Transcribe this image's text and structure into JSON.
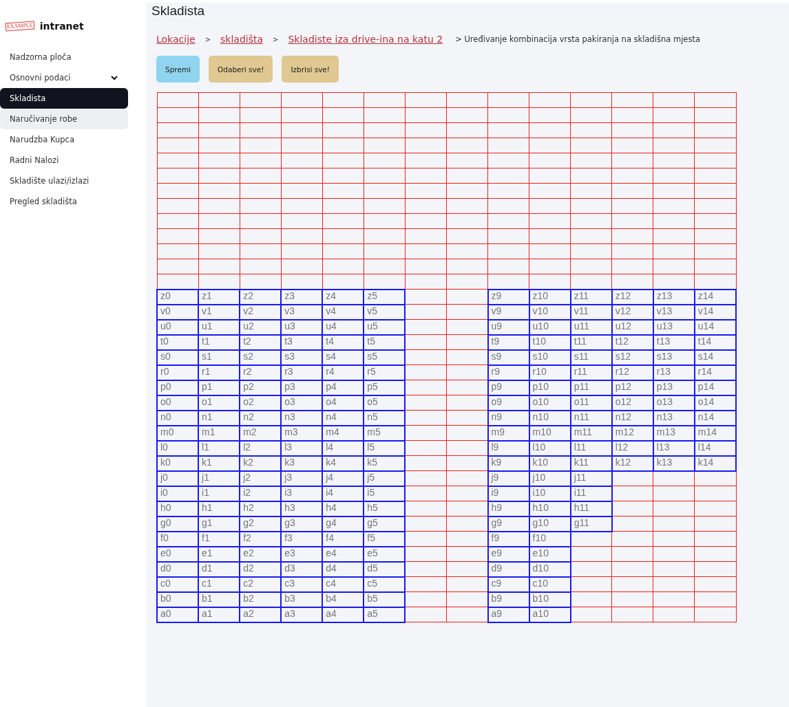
{
  "sidebar": {
    "logo_stamp": "EXAMPLE",
    "logo_text": "intranet",
    "items": [
      {
        "label": "Nadzorna ploča",
        "kind": "link",
        "selected": false,
        "hovered": false
      },
      {
        "label": "Osnovni podaci",
        "kind": "group",
        "selected": false,
        "hovered": false
      },
      {
        "label": "Skladista",
        "kind": "link",
        "selected": true,
        "hovered": false
      },
      {
        "label": "Naručivanje robe",
        "kind": "link",
        "selected": false,
        "hovered": true
      },
      {
        "label": "Narudzba Kupca",
        "kind": "link",
        "selected": false,
        "hovered": false
      },
      {
        "label": "Radni Nalozi",
        "kind": "link",
        "selected": false,
        "hovered": false
      },
      {
        "label": "Skladište ulazi/izlazi",
        "kind": "link",
        "selected": false,
        "hovered": false
      },
      {
        "label": "Pregled skladišta",
        "kind": "link",
        "selected": false,
        "hovered": false
      }
    ]
  },
  "page_title": "Skladista",
  "breadcrumbs": [
    {
      "label": "Lokacije",
      "kind": "link"
    },
    {
      "label": ">",
      "kind": "separator"
    },
    {
      "label": "skladišta",
      "kind": "link"
    },
    {
      "label": ">",
      "kind": "separator"
    },
    {
      "label": "Skladiste iza drive-ina na katu 2",
      "kind": "link"
    },
    {
      "label": "> Uređivanje kombinacija vrsta pakiranja na skladišna mjesta",
      "kind": "current"
    }
  ],
  "buttons": [
    {
      "label": "Spremi",
      "kind": "primary"
    },
    {
      "label": "Odaberi sve!",
      "kind": "secondary"
    },
    {
      "label": "Izbrisi sve!",
      "kind": "secondary"
    }
  ],
  "grid": {
    "rows": [
      {
        "cells": [
          {
            "kind": "empty"
          },
          {
            "kind": "empty"
          },
          {
            "kind": "empty"
          },
          {
            "kind": "empty"
          },
          {
            "kind": "empty"
          },
          {
            "kind": "empty"
          },
          {
            "kind": "empty"
          },
          {
            "kind": "empty"
          },
          {
            "kind": "empty"
          },
          {
            "kind": "empty"
          },
          {
            "kind": "empty"
          },
          {
            "kind": "empty"
          },
          {
            "kind": "empty"
          },
          {
            "kind": "empty"
          }
        ]
      },
      {
        "cells": [
          {
            "kind": "empty"
          },
          {
            "kind": "empty"
          },
          {
            "kind": "empty"
          },
          {
            "kind": "empty"
          },
          {
            "kind": "empty"
          },
          {
            "kind": "empty"
          },
          {
            "kind": "empty"
          },
          {
            "kind": "empty"
          },
          {
            "kind": "empty"
          },
          {
            "kind": "empty"
          },
          {
            "kind": "empty"
          },
          {
            "kind": "empty"
          },
          {
            "kind": "empty"
          },
          {
            "kind": "empty"
          }
        ]
      },
      {
        "cells": [
          {
            "kind": "empty"
          },
          {
            "kind": "empty"
          },
          {
            "kind": "empty"
          },
          {
            "kind": "empty"
          },
          {
            "kind": "empty"
          },
          {
            "kind": "empty"
          },
          {
            "kind": "empty"
          },
          {
            "kind": "empty"
          },
          {
            "kind": "empty"
          },
          {
            "kind": "empty"
          },
          {
            "kind": "empty"
          },
          {
            "kind": "empty"
          },
          {
            "kind": "empty"
          },
          {
            "kind": "empty"
          }
        ]
      },
      {
        "cells": [
          {
            "kind": "empty"
          },
          {
            "kind": "empty"
          },
          {
            "kind": "empty"
          },
          {
            "kind": "empty"
          },
          {
            "kind": "empty"
          },
          {
            "kind": "empty"
          },
          {
            "kind": "empty"
          },
          {
            "kind": "empty"
          },
          {
            "kind": "empty"
          },
          {
            "kind": "empty"
          },
          {
            "kind": "empty"
          },
          {
            "kind": "empty"
          },
          {
            "kind": "empty"
          },
          {
            "kind": "empty"
          }
        ]
      },
      {
        "cells": [
          {
            "kind": "empty"
          },
          {
            "kind": "empty"
          },
          {
            "kind": "empty"
          },
          {
            "kind": "empty"
          },
          {
            "kind": "empty"
          },
          {
            "kind": "empty"
          },
          {
            "kind": "empty"
          },
          {
            "kind": "empty"
          },
          {
            "kind": "empty"
          },
          {
            "kind": "empty"
          },
          {
            "kind": "empty"
          },
          {
            "kind": "empty"
          },
          {
            "kind": "empty"
          },
          {
            "kind": "empty"
          }
        ]
      },
      {
        "cells": [
          {
            "kind": "empty"
          },
          {
            "kind": "empty"
          },
          {
            "kind": "empty"
          },
          {
            "kind": "empty"
          },
          {
            "kind": "empty"
          },
          {
            "kind": "empty"
          },
          {
            "kind": "empty"
          },
          {
            "kind": "empty"
          },
          {
            "kind": "empty"
          },
          {
            "kind": "empty"
          },
          {
            "kind": "empty"
          },
          {
            "kind": "empty"
          },
          {
            "kind": "empty"
          },
          {
            "kind": "empty"
          }
        ]
      },
      {
        "cells": [
          {
            "kind": "empty"
          },
          {
            "kind": "empty"
          },
          {
            "kind": "empty"
          },
          {
            "kind": "empty"
          },
          {
            "kind": "empty"
          },
          {
            "kind": "empty"
          },
          {
            "kind": "empty"
          },
          {
            "kind": "empty"
          },
          {
            "kind": "empty"
          },
          {
            "kind": "empty"
          },
          {
            "kind": "empty"
          },
          {
            "kind": "empty"
          },
          {
            "kind": "empty"
          },
          {
            "kind": "empty"
          }
        ]
      },
      {
        "cells": [
          {
            "kind": "empty"
          },
          {
            "kind": "empty"
          },
          {
            "kind": "empty"
          },
          {
            "kind": "empty"
          },
          {
            "kind": "empty"
          },
          {
            "kind": "empty"
          },
          {
            "kind": "empty"
          },
          {
            "kind": "empty"
          },
          {
            "kind": "empty"
          },
          {
            "kind": "empty"
          },
          {
            "kind": "empty"
          },
          {
            "kind": "empty"
          },
          {
            "kind": "empty"
          },
          {
            "kind": "empty"
          }
        ]
      },
      {
        "cells": [
          {
            "kind": "empty"
          },
          {
            "kind": "empty"
          },
          {
            "kind": "empty"
          },
          {
            "kind": "empty"
          },
          {
            "kind": "empty"
          },
          {
            "kind": "empty"
          },
          {
            "kind": "empty"
          },
          {
            "kind": "empty"
          },
          {
            "kind": "empty"
          },
          {
            "kind": "empty"
          },
          {
            "kind": "empty"
          },
          {
            "kind": "empty"
          },
          {
            "kind": "empty"
          },
          {
            "kind": "empty"
          }
        ]
      },
      {
        "cells": [
          {
            "kind": "empty"
          },
          {
            "kind": "empty"
          },
          {
            "kind": "empty"
          },
          {
            "kind": "empty"
          },
          {
            "kind": "empty"
          },
          {
            "kind": "empty"
          },
          {
            "kind": "empty"
          },
          {
            "kind": "empty"
          },
          {
            "kind": "empty"
          },
          {
            "kind": "empty"
          },
          {
            "kind": "empty"
          },
          {
            "kind": "empty"
          },
          {
            "kind": "empty"
          },
          {
            "kind": "empty"
          }
        ]
      },
      {
        "cells": [
          {
            "kind": "empty"
          },
          {
            "kind": "empty"
          },
          {
            "kind": "empty"
          },
          {
            "kind": "empty"
          },
          {
            "kind": "empty"
          },
          {
            "kind": "empty"
          },
          {
            "kind": "empty"
          },
          {
            "kind": "empty"
          },
          {
            "kind": "empty"
          },
          {
            "kind": "empty"
          },
          {
            "kind": "empty"
          },
          {
            "kind": "empty"
          },
          {
            "kind": "empty"
          },
          {
            "kind": "empty"
          }
        ]
      },
      {
        "cells": [
          {
            "kind": "empty"
          },
          {
            "kind": "empty"
          },
          {
            "kind": "empty"
          },
          {
            "kind": "empty"
          },
          {
            "kind": "empty"
          },
          {
            "kind": "empty"
          },
          {
            "kind": "empty"
          },
          {
            "kind": "empty"
          },
          {
            "kind": "empty"
          },
          {
            "kind": "empty"
          },
          {
            "kind": "empty"
          },
          {
            "kind": "empty"
          },
          {
            "kind": "empty"
          },
          {
            "kind": "empty"
          }
        ]
      },
      {
        "cells": [
          {
            "kind": "empty"
          },
          {
            "kind": "empty"
          },
          {
            "kind": "empty"
          },
          {
            "kind": "empty"
          },
          {
            "kind": "empty"
          },
          {
            "kind": "empty"
          },
          {
            "kind": "empty"
          },
          {
            "kind": "empty"
          },
          {
            "kind": "empty"
          },
          {
            "kind": "empty"
          },
          {
            "kind": "empty"
          },
          {
            "kind": "empty"
          },
          {
            "kind": "empty"
          },
          {
            "kind": "empty"
          }
        ]
      },
      {
        "cells": [
          {
            "kind": "slot",
            "label": "z0"
          },
          {
            "kind": "slot",
            "label": "z1"
          },
          {
            "kind": "slot",
            "label": "z2"
          },
          {
            "kind": "slot",
            "label": "z3"
          },
          {
            "kind": "slot",
            "label": "z4"
          },
          {
            "kind": "slot",
            "label": "z5"
          },
          {
            "kind": "empty"
          },
          {
            "kind": "empty"
          },
          {
            "kind": "slot",
            "label": "z9"
          },
          {
            "kind": "slot",
            "label": "z10"
          },
          {
            "kind": "slot",
            "label": "z11"
          },
          {
            "kind": "slot",
            "label": "z12"
          },
          {
            "kind": "slot",
            "label": "z13"
          },
          {
            "kind": "slot",
            "label": "z14"
          }
        ]
      },
      {
        "cells": [
          {
            "kind": "slot",
            "label": "v0"
          },
          {
            "kind": "slot",
            "label": "v1"
          },
          {
            "kind": "slot",
            "label": "v2"
          },
          {
            "kind": "slot",
            "label": "v3"
          },
          {
            "kind": "slot",
            "label": "v4"
          },
          {
            "kind": "slot",
            "label": "v5"
          },
          {
            "kind": "empty"
          },
          {
            "kind": "empty"
          },
          {
            "kind": "slot",
            "label": "v9"
          },
          {
            "kind": "slot",
            "label": "v10"
          },
          {
            "kind": "slot",
            "label": "v11"
          },
          {
            "kind": "slot",
            "label": "v12"
          },
          {
            "kind": "slot",
            "label": "v13"
          },
          {
            "kind": "slot",
            "label": "v14"
          }
        ]
      },
      {
        "cells": [
          {
            "kind": "slot",
            "label": "u0"
          },
          {
            "kind": "slot",
            "label": "u1"
          },
          {
            "kind": "slot",
            "label": "u2"
          },
          {
            "kind": "slot",
            "label": "u3"
          },
          {
            "kind": "slot",
            "label": "u4"
          },
          {
            "kind": "slot",
            "label": "u5"
          },
          {
            "kind": "empty"
          },
          {
            "kind": "empty"
          },
          {
            "kind": "slot",
            "label": "u9"
          },
          {
            "kind": "slot",
            "label": "u10"
          },
          {
            "kind": "slot",
            "label": "u11"
          },
          {
            "kind": "slot",
            "label": "u12"
          },
          {
            "kind": "slot",
            "label": "u13"
          },
          {
            "kind": "slot",
            "label": "u14"
          }
        ]
      },
      {
        "cells": [
          {
            "kind": "slot",
            "label": "t0"
          },
          {
            "kind": "slot",
            "label": "t1"
          },
          {
            "kind": "slot",
            "label": "t2"
          },
          {
            "kind": "slot",
            "label": "t3"
          },
          {
            "kind": "slot",
            "label": "t4"
          },
          {
            "kind": "slot",
            "label": "t5"
          },
          {
            "kind": "empty"
          },
          {
            "kind": "empty"
          },
          {
            "kind": "slot",
            "label": "t9"
          },
          {
            "kind": "slot",
            "label": "t10"
          },
          {
            "kind": "slot",
            "label": "t11"
          },
          {
            "kind": "slot",
            "label": "t12"
          },
          {
            "kind": "slot",
            "label": "t13"
          },
          {
            "kind": "slot",
            "label": "t14"
          }
        ]
      },
      {
        "cells": [
          {
            "kind": "slot",
            "label": "s0"
          },
          {
            "kind": "slot",
            "label": "s1"
          },
          {
            "kind": "slot",
            "label": "s2"
          },
          {
            "kind": "slot",
            "label": "s3"
          },
          {
            "kind": "slot",
            "label": "s4"
          },
          {
            "kind": "slot",
            "label": "s5"
          },
          {
            "kind": "empty"
          },
          {
            "kind": "empty"
          },
          {
            "kind": "slot",
            "label": "s9"
          },
          {
            "kind": "slot",
            "label": "s10"
          },
          {
            "kind": "slot",
            "label": "s11"
          },
          {
            "kind": "slot",
            "label": "s12"
          },
          {
            "kind": "slot",
            "label": "s13"
          },
          {
            "kind": "slot",
            "label": "s14"
          }
        ]
      },
      {
        "cells": [
          {
            "kind": "slot",
            "label": "r0"
          },
          {
            "kind": "slot",
            "label": "r1"
          },
          {
            "kind": "slot",
            "label": "r2"
          },
          {
            "kind": "slot",
            "label": "r3"
          },
          {
            "kind": "slot",
            "label": "r4"
          },
          {
            "kind": "slot",
            "label": "r5"
          },
          {
            "kind": "empty"
          },
          {
            "kind": "empty"
          },
          {
            "kind": "slot",
            "label": "r9"
          },
          {
            "kind": "slot",
            "label": "r10"
          },
          {
            "kind": "slot",
            "label": "r11"
          },
          {
            "kind": "slot",
            "label": "r12"
          },
          {
            "kind": "slot",
            "label": "r13"
          },
          {
            "kind": "slot",
            "label": "r14"
          }
        ]
      },
      {
        "cells": [
          {
            "kind": "slot",
            "label": "p0"
          },
          {
            "kind": "slot",
            "label": "p1"
          },
          {
            "kind": "slot",
            "label": "p2"
          },
          {
            "kind": "slot",
            "label": "p3"
          },
          {
            "kind": "slot",
            "label": "p4"
          },
          {
            "kind": "slot",
            "label": "p5"
          },
          {
            "kind": "empty"
          },
          {
            "kind": "empty"
          },
          {
            "kind": "slot",
            "label": "p9"
          },
          {
            "kind": "slot",
            "label": "p10"
          },
          {
            "kind": "slot",
            "label": "p11"
          },
          {
            "kind": "slot",
            "label": "p12"
          },
          {
            "kind": "slot",
            "label": "p13"
          },
          {
            "kind": "slot",
            "label": "p14"
          }
        ]
      },
      {
        "cells": [
          {
            "kind": "slot",
            "label": "o0"
          },
          {
            "kind": "slot",
            "label": "o1"
          },
          {
            "kind": "slot",
            "label": "o2"
          },
          {
            "kind": "slot",
            "label": "o3"
          },
          {
            "kind": "slot",
            "label": "o4"
          },
          {
            "kind": "slot",
            "label": "o5"
          },
          {
            "kind": "empty"
          },
          {
            "kind": "empty"
          },
          {
            "kind": "slot",
            "label": "o9"
          },
          {
            "kind": "slot",
            "label": "o10"
          },
          {
            "kind": "slot",
            "label": "o11"
          },
          {
            "kind": "slot",
            "label": "o12"
          },
          {
            "kind": "slot",
            "label": "o13"
          },
          {
            "kind": "slot",
            "label": "o14"
          }
        ]
      },
      {
        "cells": [
          {
            "kind": "slot",
            "label": "n0"
          },
          {
            "kind": "slot",
            "label": "n1"
          },
          {
            "kind": "slot",
            "label": "n2"
          },
          {
            "kind": "slot",
            "label": "n3"
          },
          {
            "kind": "slot",
            "label": "n4"
          },
          {
            "kind": "slot",
            "label": "n5"
          },
          {
            "kind": "empty"
          },
          {
            "kind": "empty"
          },
          {
            "kind": "slot",
            "label": "n9"
          },
          {
            "kind": "slot",
            "label": "n10"
          },
          {
            "kind": "slot",
            "label": "n11"
          },
          {
            "kind": "slot",
            "label": "n12"
          },
          {
            "kind": "slot",
            "label": "n13"
          },
          {
            "kind": "slot",
            "label": "n14"
          }
        ]
      },
      {
        "cells": [
          {
            "kind": "slot",
            "label": "m0"
          },
          {
            "kind": "slot",
            "label": "m1"
          },
          {
            "kind": "slot",
            "label": "m2"
          },
          {
            "kind": "slot",
            "label": "m3"
          },
          {
            "kind": "slot",
            "label": "m4"
          },
          {
            "kind": "slot",
            "label": "m5"
          },
          {
            "kind": "empty"
          },
          {
            "kind": "empty"
          },
          {
            "kind": "slot",
            "label": "m9"
          },
          {
            "kind": "slot",
            "label": "m10"
          },
          {
            "kind": "slot",
            "label": "m11"
          },
          {
            "kind": "slot",
            "label": "m12"
          },
          {
            "kind": "slot",
            "label": "m13"
          },
          {
            "kind": "slot",
            "label": "m14"
          }
        ]
      },
      {
        "cells": [
          {
            "kind": "slot",
            "label": "l0"
          },
          {
            "kind": "slot",
            "label": "l1"
          },
          {
            "kind": "slot",
            "label": "l2"
          },
          {
            "kind": "slot",
            "label": "l3"
          },
          {
            "kind": "slot",
            "label": "l4"
          },
          {
            "kind": "slot",
            "label": "l5"
          },
          {
            "kind": "empty"
          },
          {
            "kind": "empty"
          },
          {
            "kind": "slot",
            "label": "l9"
          },
          {
            "kind": "slot",
            "label": "l10"
          },
          {
            "kind": "slot",
            "label": "l11"
          },
          {
            "kind": "slot",
            "label": "l12"
          },
          {
            "kind": "slot",
            "label": "l13"
          },
          {
            "kind": "slot",
            "label": "l14"
          }
        ]
      },
      {
        "cells": [
          {
            "kind": "slot",
            "label": "k0"
          },
          {
            "kind": "slot",
            "label": "k1"
          },
          {
            "kind": "slot",
            "label": "k2"
          },
          {
            "kind": "slot",
            "label": "k3"
          },
          {
            "kind": "slot",
            "label": "k4"
          },
          {
            "kind": "slot",
            "label": "k5"
          },
          {
            "kind": "empty"
          },
          {
            "kind": "empty"
          },
          {
            "kind": "slot",
            "label": "k9"
          },
          {
            "kind": "slot",
            "label": "k10"
          },
          {
            "kind": "slot",
            "label": "k11"
          },
          {
            "kind": "slot",
            "label": "k12"
          },
          {
            "kind": "slot",
            "label": "k13"
          },
          {
            "kind": "slot",
            "label": "k14"
          }
        ]
      },
      {
        "cells": [
          {
            "kind": "slot",
            "label": "j0"
          },
          {
            "kind": "slot",
            "label": "j1"
          },
          {
            "kind": "slot",
            "label": "j2"
          },
          {
            "kind": "slot",
            "label": "j3"
          },
          {
            "kind": "slot",
            "label": "j4"
          },
          {
            "kind": "slot",
            "label": "j5"
          },
          {
            "kind": "empty"
          },
          {
            "kind": "empty"
          },
          {
            "kind": "slot",
            "label": "j9"
          },
          {
            "kind": "slot",
            "label": "j10"
          },
          {
            "kind": "slot",
            "label": "j11"
          },
          {
            "kind": "empty"
          },
          {
            "kind": "empty"
          },
          {
            "kind": "empty"
          }
        ]
      },
      {
        "cells": [
          {
            "kind": "slot",
            "label": "i0"
          },
          {
            "kind": "slot",
            "label": "i1"
          },
          {
            "kind": "slot",
            "label": "i2"
          },
          {
            "kind": "slot",
            "label": "i3"
          },
          {
            "kind": "slot",
            "label": "i4"
          },
          {
            "kind": "slot",
            "label": "i5"
          },
          {
            "kind": "empty"
          },
          {
            "kind": "empty"
          },
          {
            "kind": "slot",
            "label": "i9"
          },
          {
            "kind": "slot",
            "label": "i10"
          },
          {
            "kind": "slot",
            "label": "i11"
          },
          {
            "kind": "empty"
          },
          {
            "kind": "empty"
          },
          {
            "kind": "empty"
          }
        ]
      },
      {
        "cells": [
          {
            "kind": "slot",
            "label": "h0"
          },
          {
            "kind": "slot",
            "label": "h1"
          },
          {
            "kind": "slot",
            "label": "h2"
          },
          {
            "kind": "slot",
            "label": "h3"
          },
          {
            "kind": "slot",
            "label": "h4"
          },
          {
            "kind": "slot",
            "label": "h5"
          },
          {
            "kind": "empty"
          },
          {
            "kind": "empty"
          },
          {
            "kind": "slot",
            "label": "h9"
          },
          {
            "kind": "slot",
            "label": "h10"
          },
          {
            "kind": "slot",
            "label": "h11"
          },
          {
            "kind": "empty"
          },
          {
            "kind": "empty"
          },
          {
            "kind": "empty"
          }
        ]
      },
      {
        "cells": [
          {
            "kind": "slot",
            "label": "g0"
          },
          {
            "kind": "slot",
            "label": "g1"
          },
          {
            "kind": "slot",
            "label": "g2"
          },
          {
            "kind": "slot",
            "label": "g3"
          },
          {
            "kind": "slot",
            "label": "g4"
          },
          {
            "kind": "slot",
            "label": "g5"
          },
          {
            "kind": "empty"
          },
          {
            "kind": "empty"
          },
          {
            "kind": "slot",
            "label": "g9"
          },
          {
            "kind": "slot",
            "label": "g10"
          },
          {
            "kind": "slot",
            "label": "g11"
          },
          {
            "kind": "empty"
          },
          {
            "kind": "empty"
          },
          {
            "kind": "empty"
          }
        ]
      },
      {
        "cells": [
          {
            "kind": "slot",
            "label": "f0"
          },
          {
            "kind": "slot",
            "label": "f1"
          },
          {
            "kind": "slot",
            "label": "f2"
          },
          {
            "kind": "slot",
            "label": "f3"
          },
          {
            "kind": "slot",
            "label": "f4"
          },
          {
            "kind": "slot",
            "label": "f5"
          },
          {
            "kind": "empty"
          },
          {
            "kind": "empty"
          },
          {
            "kind": "slot",
            "label": "f9"
          },
          {
            "kind": "slot",
            "label": "f10"
          },
          {
            "kind": "empty"
          },
          {
            "kind": "empty"
          },
          {
            "kind": "empty"
          },
          {
            "kind": "empty"
          }
        ]
      },
      {
        "cells": [
          {
            "kind": "slot",
            "label": "e0"
          },
          {
            "kind": "slot",
            "label": "e1"
          },
          {
            "kind": "slot",
            "label": "e2"
          },
          {
            "kind": "slot",
            "label": "e3"
          },
          {
            "kind": "slot",
            "label": "e4"
          },
          {
            "kind": "slot",
            "label": "e5"
          },
          {
            "kind": "empty"
          },
          {
            "kind": "empty"
          },
          {
            "kind": "slot",
            "label": "e9"
          },
          {
            "kind": "slot",
            "label": "e10"
          },
          {
            "kind": "empty"
          },
          {
            "kind": "empty"
          },
          {
            "kind": "empty"
          },
          {
            "kind": "empty"
          }
        ]
      },
      {
        "cells": [
          {
            "kind": "slot",
            "label": "d0"
          },
          {
            "kind": "slot",
            "label": "d1"
          },
          {
            "kind": "slot",
            "label": "d2"
          },
          {
            "kind": "slot",
            "label": "d3"
          },
          {
            "kind": "slot",
            "label": "d4"
          },
          {
            "kind": "slot",
            "label": "d5"
          },
          {
            "kind": "empty"
          },
          {
            "kind": "empty"
          },
          {
            "kind": "slot",
            "label": "d9"
          },
          {
            "kind": "slot",
            "label": "d10"
          },
          {
            "kind": "empty"
          },
          {
            "kind": "empty"
          },
          {
            "kind": "empty"
          },
          {
            "kind": "empty"
          }
        ]
      },
      {
        "cells": [
          {
            "kind": "slot",
            "label": "c0"
          },
          {
            "kind": "slot",
            "label": "c1"
          },
          {
            "kind": "slot",
            "label": "c2"
          },
          {
            "kind": "slot",
            "label": "c3"
          },
          {
            "kind": "slot",
            "label": "c4"
          },
          {
            "kind": "slot",
            "label": "c5"
          },
          {
            "kind": "empty"
          },
          {
            "kind": "empty"
          },
          {
            "kind": "slot",
            "label": "c9"
          },
          {
            "kind": "slot",
            "label": "c10"
          },
          {
            "kind": "empty"
          },
          {
            "kind": "empty"
          },
          {
            "kind": "empty"
          },
          {
            "kind": "empty"
          }
        ]
      },
      {
        "cells": [
          {
            "kind": "slot",
            "label": "b0"
          },
          {
            "kind": "slot",
            "label": "b1"
          },
          {
            "kind": "slot",
            "label": "b2"
          },
          {
            "kind": "slot",
            "label": "b3"
          },
          {
            "kind": "slot",
            "label": "b4"
          },
          {
            "kind": "slot",
            "label": "b5"
          },
          {
            "kind": "empty"
          },
          {
            "kind": "empty"
          },
          {
            "kind": "slot",
            "label": "b9"
          },
          {
            "kind": "slot",
            "label": "b10"
          },
          {
            "kind": "empty"
          },
          {
            "kind": "empty"
          },
          {
            "kind": "empty"
          },
          {
            "kind": "empty"
          }
        ]
      },
      {
        "cells": [
          {
            "kind": "slot",
            "label": "a0"
          },
          {
            "kind": "slot",
            "label": "a1"
          },
          {
            "kind": "slot",
            "label": "a2"
          },
          {
            "kind": "slot",
            "label": "a3"
          },
          {
            "kind": "slot",
            "label": "a4"
          },
          {
            "kind": "slot",
            "label": "a5"
          },
          {
            "kind": "empty"
          },
          {
            "kind": "empty"
          },
          {
            "kind": "slot",
            "label": "a9"
          },
          {
            "kind": "slot",
            "label": "a10"
          },
          {
            "kind": "empty"
          },
          {
            "kind": "empty"
          },
          {
            "kind": "empty"
          },
          {
            "kind": "empty"
          }
        ]
      }
    ]
  }
}
